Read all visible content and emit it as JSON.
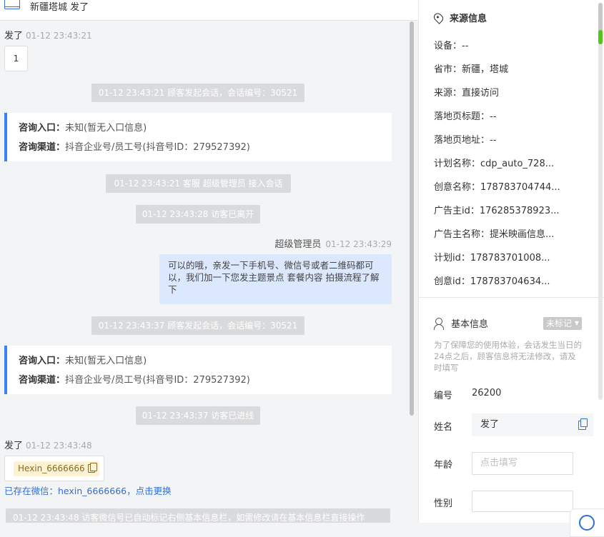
{
  "header": {
    "title": "新疆塔城  发了"
  },
  "chat": {
    "msg1": {
      "sender": "发了",
      "time": "01-12 23:43:21",
      "content": "1"
    },
    "sys1": "01-12 23:43:21 顾客发起会话，会话编号：30521",
    "card1": {
      "entry_label": "咨询入口：",
      "entry_value": "未知(暂无入口信息)",
      "channel_label": "咨询渠道：",
      "channel_value": "抖音企业号/员工号(抖音号ID：279527392)"
    },
    "sys2": "01-12 23:43:21 客服 超级管理员 接入会话",
    "sys3": "01-12 23:43:28 访客已离开",
    "agent_msg": {
      "sender": "超级管理员",
      "time": "01-12 23:43:29",
      "content": "可以的哦，亲发一下手机号、微信号或者二维码都可以，我们加一下您发主题景点 套餐内容 拍摄流程了解下"
    },
    "sys4": "01-12 23:43:37 顾客发起会话，会话编号：30521",
    "card2": {
      "entry_label": "咨询入口：",
      "entry_value": "未知(暂无入口信息)",
      "channel_label": "咨询渠道：",
      "channel_value": "抖音企业号/员工号(抖音号ID：279527392)"
    },
    "sys5": "01-12 23:43:37 访客已进线",
    "msg2": {
      "sender": "发了",
      "time": "01-12 23:43:48"
    },
    "wechat_tag": "Hexin_6666666",
    "wechat_link": "已存在微信：hexin_6666666，点击更换",
    "sys6": "01-12 23:43:48 访客微信号已自动标记右侧基本信息栏，如需修改请在基本信息栏直接操作"
  },
  "source": {
    "title": "来源信息",
    "rows": [
      "设备：--",
      "省市：新疆，塔城",
      "来源：直接访问",
      "落地页标题：--",
      "落地页地址：--",
      "计划名称：cdp_auto_728...",
      "创意名称：178783704744...",
      "广告主id：176285378923...",
      "广告主名称：提米映画信息...",
      "计划id：178783701008...",
      "创意id：178783704634..."
    ]
  },
  "basic": {
    "title": "基本信息",
    "badge": "未标记",
    "hint": "为了保障您的使用体验，会话发生当日的24点之后，顾客信息将无法修改，请及时填写",
    "id_label": "编号",
    "id_value": "26200",
    "name_label": "姓名",
    "name_value": "发了",
    "age_label": "年龄",
    "age_placeholder": "点击填写",
    "gender_label": "性别"
  },
  "icons": [
    "window-icon",
    "location-pin-icon",
    "user-list-icon",
    "copy-icon",
    "chevron-down-icon",
    "help-float-icon"
  ]
}
